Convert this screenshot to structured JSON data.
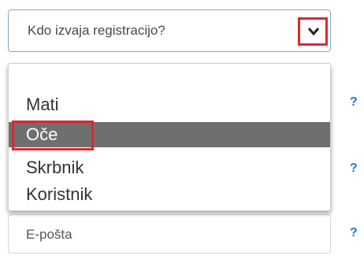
{
  "select": {
    "placeholder": "Kdo izvaja registracijo?",
    "toggle_icon": "chevron-down-icon"
  },
  "dropdown": {
    "options": [
      {
        "label": ""
      },
      {
        "label": "Mati"
      },
      {
        "label": "Oče"
      },
      {
        "label": "Skrbnik"
      },
      {
        "label": "Koristnik"
      }
    ],
    "selected_index": 2
  },
  "email": {
    "placeholder": "E-pošta"
  },
  "help": {
    "label": "?"
  },
  "colors": {
    "accent_border": "#7fa9c9",
    "highlight_red": "#e0262f",
    "selected_bg": "#6f6f6f",
    "help_blue": "#2a78c7"
  }
}
